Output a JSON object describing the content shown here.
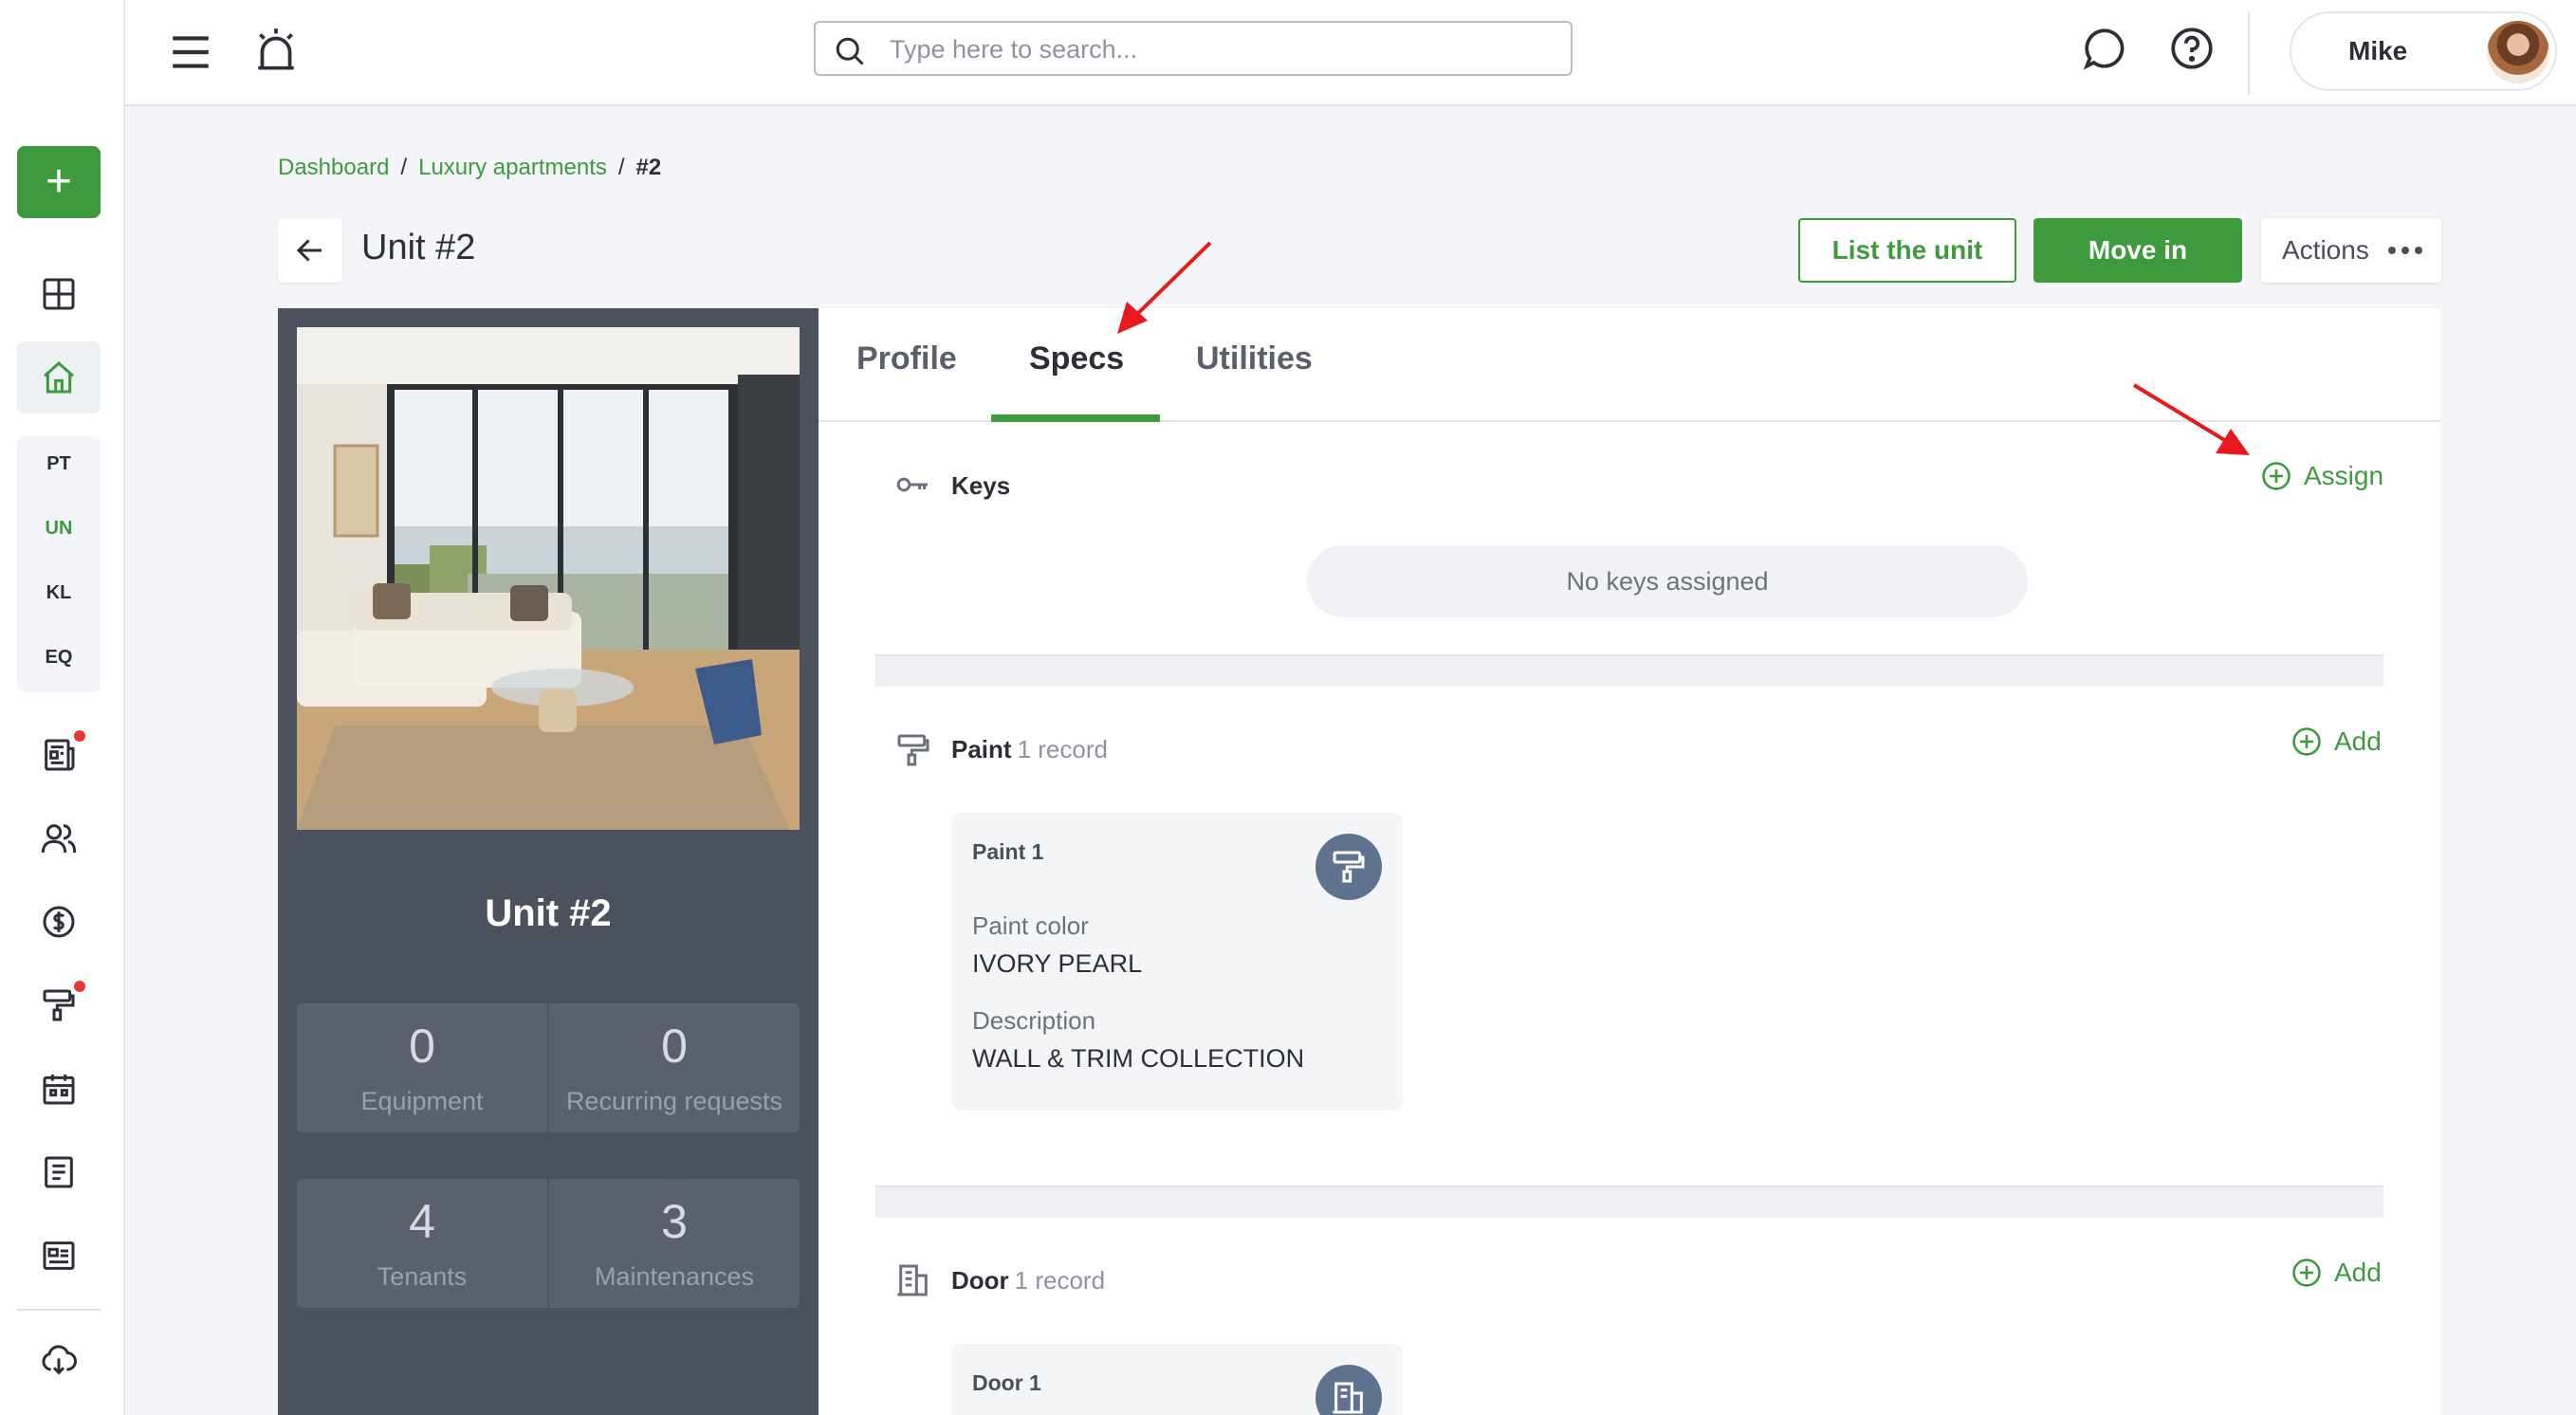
{
  "topbar": {
    "search_placeholder": "Type here to search...",
    "user_name": "Mike"
  },
  "rail": {
    "sub_items": [
      "PT",
      "UN",
      "KL",
      "EQ"
    ],
    "active_sub": "UN"
  },
  "breadcrumb": [
    "Dashboard",
    "Luxury apartments",
    "#2"
  ],
  "header": {
    "title": "Unit #2",
    "list_button": "List the unit",
    "move_in_button": "Move in",
    "actions_button": "Actions"
  },
  "unit_card": {
    "name": "Unit #2",
    "stats": [
      {
        "value": "0",
        "label": "Equipment"
      },
      {
        "value": "0",
        "label": "Recurring requests"
      },
      {
        "value": "4",
        "label": "Tenants"
      },
      {
        "value": "3",
        "label": "Maintenances"
      }
    ]
  },
  "tabs": [
    "Profile",
    "Specs",
    "Utilities"
  ],
  "active_tab": "Specs",
  "keys": {
    "title": "Keys",
    "action": "Assign",
    "empty": "No keys assigned"
  },
  "paint": {
    "title": "Paint",
    "count": "1 record",
    "action": "Add",
    "record": {
      "name": "Paint 1",
      "fields": [
        {
          "label": "Paint color",
          "value": "IVORY PEARL"
        },
        {
          "label": "Description",
          "value": "WALL & TRIM COLLECTION"
        }
      ]
    }
  },
  "door": {
    "title": "Door",
    "count": "1 record",
    "action": "Add",
    "record": {
      "name": "Door 1"
    }
  },
  "colors": {
    "accent": "#3d9b3e",
    "sidebar_dark": "#4b515d",
    "badge": "#5f7290",
    "annotation": "#e8191c"
  }
}
